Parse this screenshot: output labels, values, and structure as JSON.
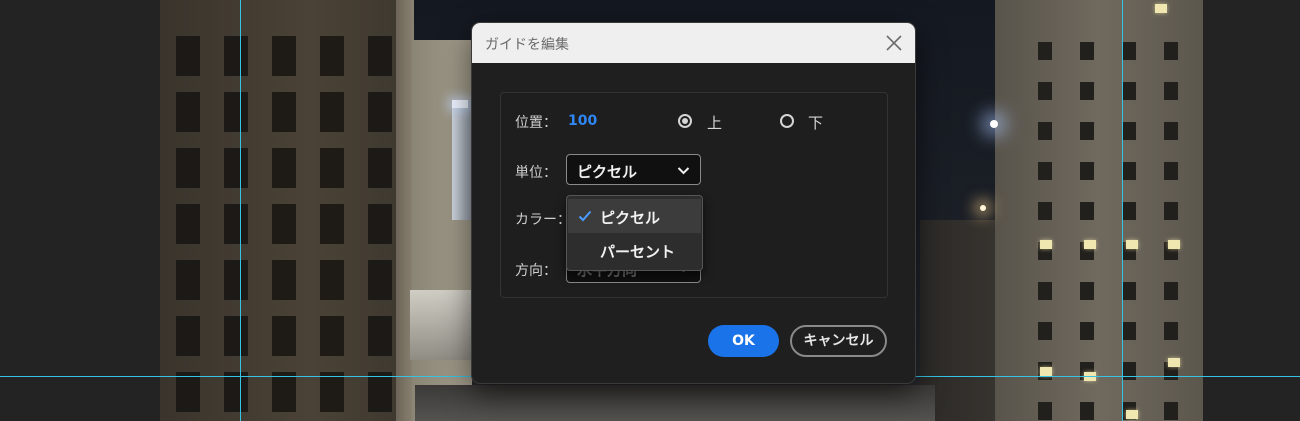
{
  "dialog": {
    "title": "ガイドを編集",
    "position": {
      "label": "位置：",
      "value": "100"
    },
    "anchor": [
      {
        "label": "上",
        "checked": true
      },
      {
        "label": "下",
        "checked": false
      }
    ],
    "unit": {
      "label": "単位：",
      "selected": "ピクセル",
      "options": [
        {
          "label": "ピクセル",
          "selected": true
        },
        {
          "label": "パーセント",
          "selected": false
        }
      ]
    },
    "color": {
      "label": "カラー："
    },
    "orientation": {
      "label": "方向：",
      "value": "水平方向"
    },
    "buttons": {
      "ok": "OK",
      "cancel": "キャンセル"
    }
  },
  "colors": {
    "accent": "#1a73e8",
    "value_blue": "#2f86f5",
    "guide": "#36c3e6",
    "dialog_bg": "#1f1f1f",
    "titlebar_bg": "#efefef"
  },
  "icons": {
    "close": "close-icon",
    "chevron": "chevron-down-icon",
    "check": "check-icon"
  }
}
